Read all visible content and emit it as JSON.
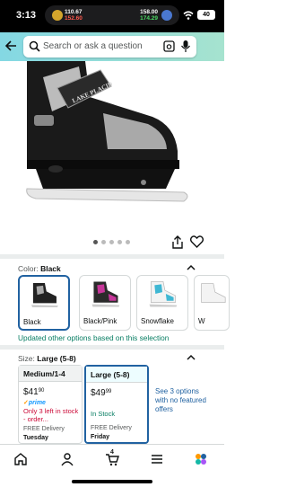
{
  "status_bar": {
    "time": "3:13",
    "ticker_left_price": "110.67",
    "ticker_left_change": "152.60",
    "ticker_right_price": "158.00",
    "ticker_right_change": "174.29",
    "battery": "40"
  },
  "search": {
    "placeholder": "Search or ask a question"
  },
  "gallery": {
    "image_count": 5,
    "active_index": 0,
    "brand_text": "LAKE PLACID"
  },
  "color_section": {
    "label": "Color:",
    "selected_value": "Black",
    "options": [
      {
        "name": "Black",
        "selected": true
      },
      {
        "name": "Black/Pink",
        "selected": false
      },
      {
        "name": "Snowflake",
        "selected": false
      },
      {
        "name": "W",
        "selected": false
      }
    ],
    "updated_note": "Updated other options based on this selection"
  },
  "size_section": {
    "label": "Size:",
    "selected_value": "Large (5-8)",
    "options": [
      {
        "name": "Medium/1-4",
        "price_whole": "$41",
        "price_fraction": "90",
        "prime": "prime",
        "stock": "Only 3 left in stock - order...",
        "delivery_label": "FREE Delivery",
        "delivery_day": "Tuesday",
        "selected": false
      },
      {
        "name": "Large (5-8)",
        "price_whole": "$49",
        "price_fraction": "99",
        "stock": "In Stock",
        "delivery_label": "FREE Delivery",
        "delivery_day": "Friday",
        "selected": true
      }
    ],
    "see_more": "See 3 options with no featured offers"
  },
  "bottom_nav": {
    "cart_count": "4"
  },
  "colors": {
    "link": "#2162a1",
    "in_stock": "#067d62",
    "low_stock": "#cc0c39",
    "prime": "#1399ff"
  }
}
